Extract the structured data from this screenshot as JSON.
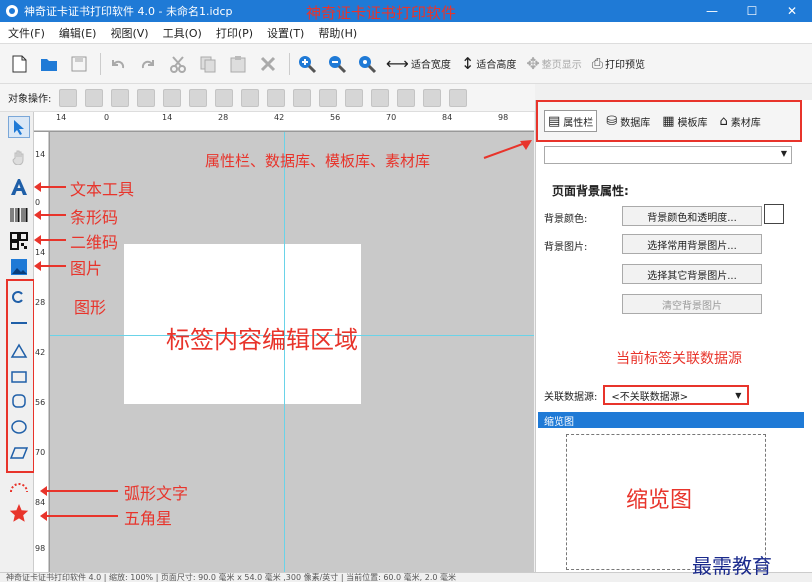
{
  "titlebar": {
    "title": "神奇证卡证书打印软件 4.0 - 未命名1.idcp",
    "annotation": "神奇证卡证书打印软件",
    "controls": [
      "—",
      "☐",
      "✕"
    ]
  },
  "menu": [
    "文件(F)",
    "编辑(E)",
    "视图(V)",
    "工具(O)",
    "打印(P)",
    "设置(T)",
    "帮助(H)"
  ],
  "toolbar": {
    "fit_width": "适合宽度",
    "fit_height": "适合高度",
    "page_display": "整页显示",
    "print_preview": "打印预览"
  },
  "objbar": {
    "label": "对象操作:"
  },
  "rulers": {
    "top": [
      "14",
      "0",
      "14",
      "28",
      "42",
      "56",
      "70",
      "84",
      "98"
    ],
    "left": [
      "14",
      "0",
      "14",
      "28",
      "42",
      "56",
      "70",
      "84",
      "98"
    ]
  },
  "canvas": {
    "annotation": "标签内容编辑区域"
  },
  "annotations": {
    "tabs": "属性栏、数据库、模板库、素材库",
    "text_tool": "文本工具",
    "barcode": "条形码",
    "qrcode": "二维码",
    "image": "图片",
    "shapes": "图形",
    "arc_text": "弧形文字",
    "star": "五角星"
  },
  "right_panel": {
    "tabs": [
      {
        "icon": "▤",
        "label": "属性栏"
      },
      {
        "icon": "⛁",
        "label": "数据库"
      },
      {
        "icon": "▦",
        "label": "模板库"
      },
      {
        "icon": "⌂",
        "label": "素材库"
      }
    ],
    "section_title": "页面背景属性:",
    "bg_color_label": "背景颜色:",
    "bg_color_button": "背景颜色和透明度...",
    "bg_image_label": "背景图片:",
    "bg_image_common": "选择常用背景图片...",
    "bg_image_other": "选择其它背景图片...",
    "bg_image_clear": "清空背景图片",
    "datasource_annotation": "当前标签关联数据源",
    "datasource_label": "关联数据源:",
    "datasource_value": "<不关联数据源>",
    "thumbnail_header": "缩览图",
    "thumbnail_annotation": "缩览图"
  },
  "statusbar": "神奇证卡证书打印软件 4.0  |  缩放: 100%  |  页面尺寸: 90.0 毫米 x 54.0 毫米 ,300 像素/英寸  |  当前位置: 60.0 毫米, 2.0 毫米",
  "watermark": "最需教育",
  "colors": {
    "accent": "#1f7ad6",
    "annotation": "#e8342b",
    "canvas_bg": "#c9c9c9",
    "guide": "#6ad3e8"
  }
}
